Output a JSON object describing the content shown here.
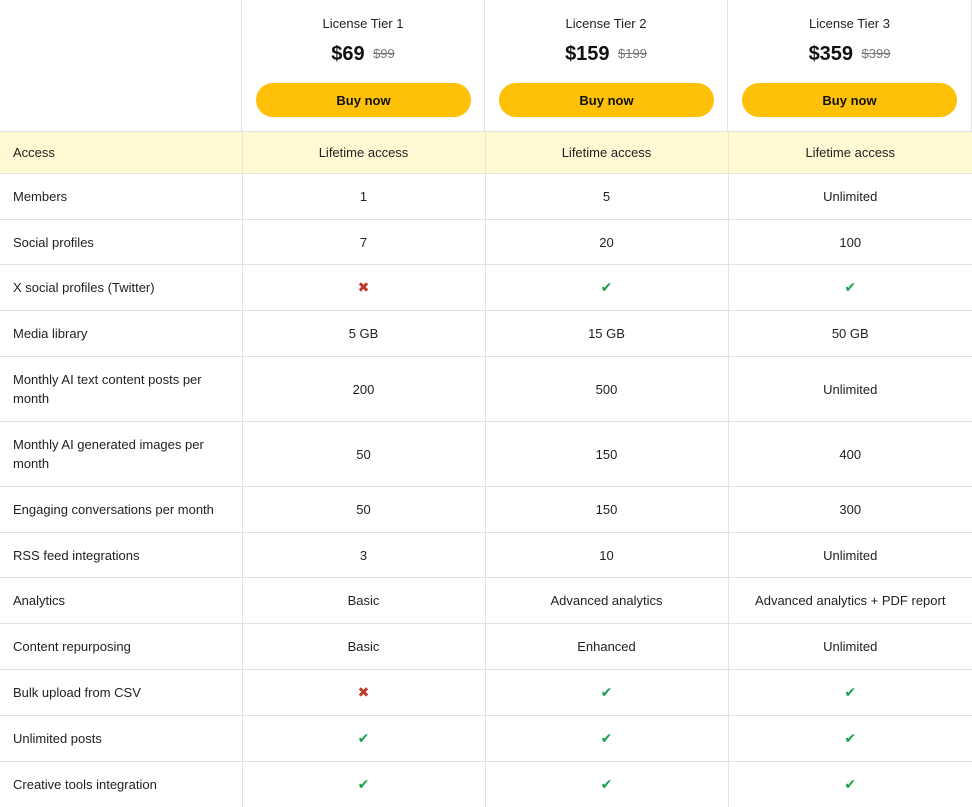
{
  "tiers": [
    {
      "name": "License Tier 1",
      "price": "$69",
      "old_price": "$99",
      "button": "Buy now"
    },
    {
      "name": "License Tier 2",
      "price": "$159",
      "old_price": "$199",
      "button": "Buy now"
    },
    {
      "name": "License Tier 3",
      "price": "$359",
      "old_price": "$399",
      "button": "Buy now"
    }
  ],
  "icons": {
    "yes": "check-icon",
    "no": "x-icon",
    "yes_glyph": "✔",
    "no_glyph": "✖"
  },
  "colors": {
    "button": "#ffc107",
    "highlight_row": "#fff9d4",
    "check": "#16a34a",
    "cross": "#c0392b"
  },
  "rows": [
    {
      "feature": "Access",
      "values": [
        "Lifetime access",
        "Lifetime access",
        "Lifetime access"
      ],
      "highlight": true
    },
    {
      "feature": "Members",
      "values": [
        "1",
        "5",
        "Unlimited"
      ]
    },
    {
      "feature": "Social profiles",
      "values": [
        "7",
        "20",
        "100"
      ]
    },
    {
      "feature": "X social profiles (Twitter)",
      "values": [
        "no",
        "yes",
        "yes"
      ]
    },
    {
      "feature": "Media library",
      "values": [
        "5 GB",
        "15 GB",
        "50 GB"
      ]
    },
    {
      "feature": "Monthly AI text content posts per month",
      "values": [
        "200",
        "500",
        "Unlimited"
      ]
    },
    {
      "feature": "Monthly AI generated images per month",
      "values": [
        "50",
        "150",
        "400"
      ]
    },
    {
      "feature": "Engaging conversations per month",
      "values": [
        "50",
        "150",
        "300"
      ]
    },
    {
      "feature": "RSS feed integrations",
      "values": [
        "3",
        "10",
        "Unlimited"
      ]
    },
    {
      "feature": "Analytics",
      "values": [
        "Basic",
        "Advanced analytics",
        "Advanced analytics + PDF report"
      ]
    },
    {
      "feature": "Content repurposing",
      "values": [
        "Basic",
        "Enhanced",
        "Unlimited"
      ]
    },
    {
      "feature": "Bulk upload from CSV",
      "values": [
        "no",
        "yes",
        "yes"
      ]
    },
    {
      "feature": "Unlimited posts",
      "values": [
        "yes",
        "yes",
        "yes"
      ]
    },
    {
      "feature": "Creative tools integration",
      "values": [
        "yes",
        "yes",
        "yes"
      ]
    }
  ]
}
